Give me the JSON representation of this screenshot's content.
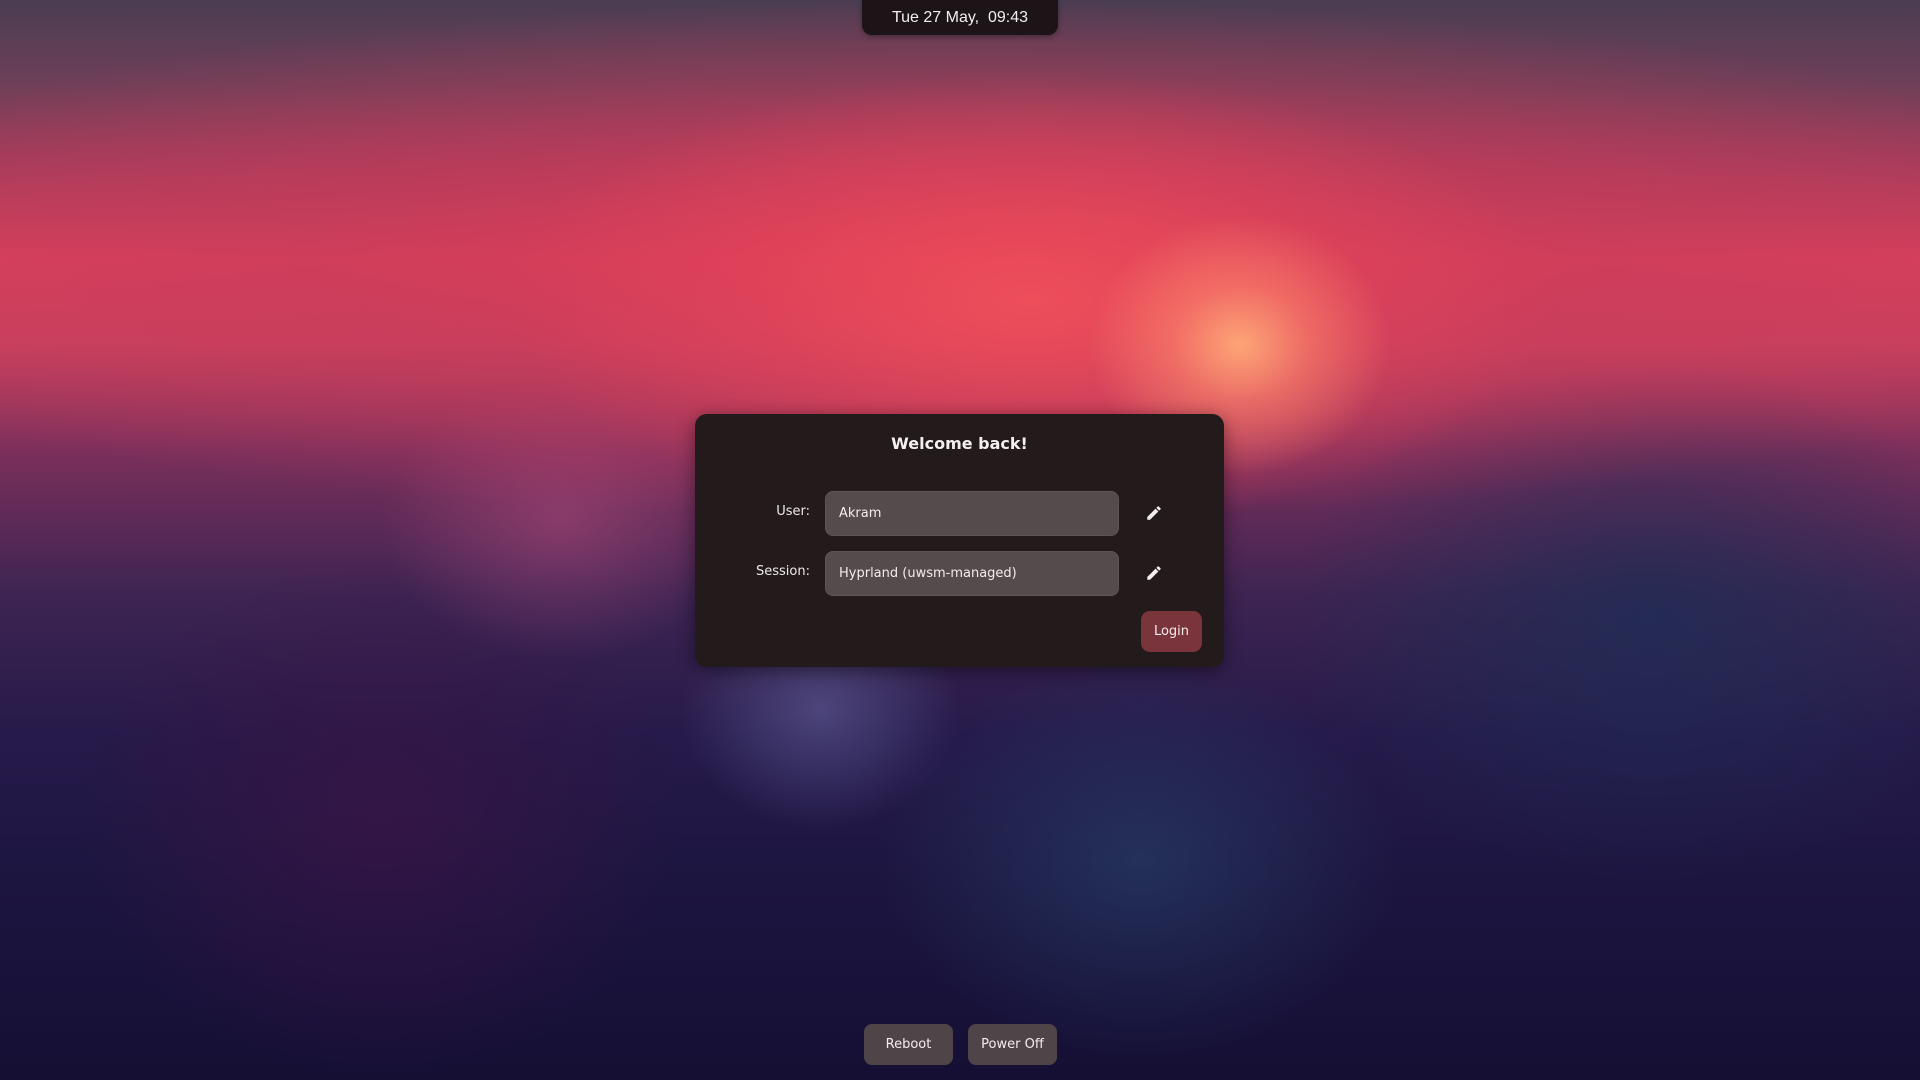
{
  "topbar": {
    "datetime": "Tue 27 May,  09:43"
  },
  "dialog": {
    "title": "Welcome back!",
    "user": {
      "label": "User:",
      "value": "Akram",
      "edit_icon": "pencil-icon"
    },
    "session": {
      "label": "Session:",
      "value": "Hyprland (uwsm-managed)",
      "edit_icon": "pencil-icon"
    },
    "login_label": "Login"
  },
  "power": {
    "reboot_label": "Reboot",
    "poweroff_label": "Power Off"
  },
  "colors": {
    "panel": "#231a1c",
    "field": "#564b4c",
    "accent_login": "#7a343c",
    "button": "#4f4448"
  }
}
